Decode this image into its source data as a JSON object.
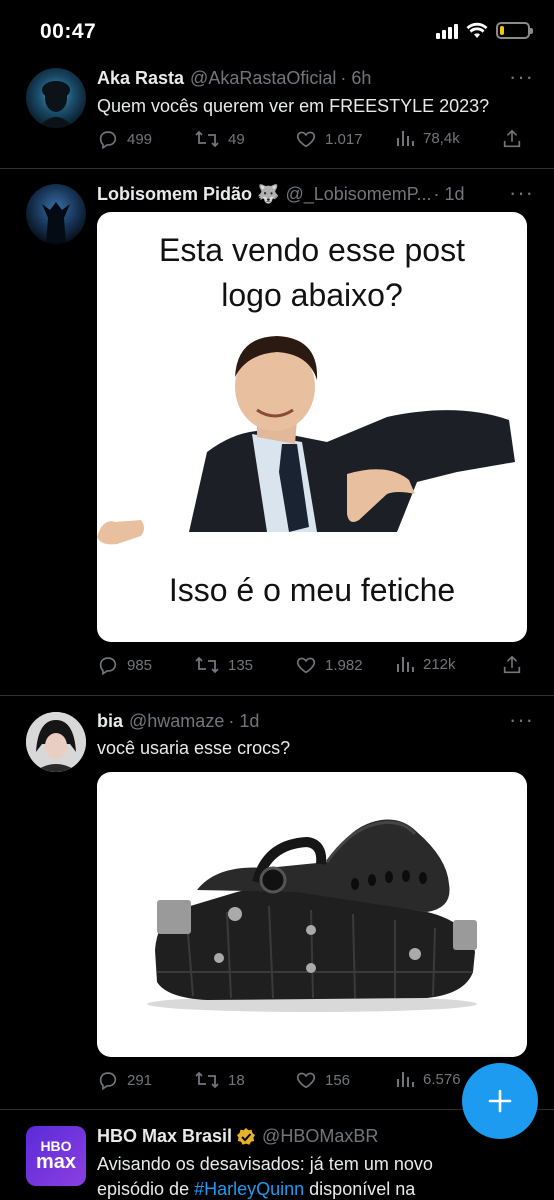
{
  "status": {
    "time": "00:47"
  },
  "tweets": [
    {
      "name": "Aka Rasta",
      "handle": "@AkaRastaOficial",
      "time": "· 6h",
      "text": "Quem vocês querem ver em FREESTYLE 2023?",
      "replies": "499",
      "retweets": "49",
      "likes": "1.017",
      "views": "78,4k"
    },
    {
      "name": "Lobisomem Pidão 🐺",
      "handle": "@_LobisomemP...",
      "time": "· 1d",
      "media": {
        "top_text_1": "Esta vendo esse post",
        "top_text_2": "logo abaixo?",
        "bottom_text": "Isso é o meu fetiche"
      },
      "replies": "985",
      "retweets": "135",
      "likes": "1.982",
      "views": "212k"
    },
    {
      "name": "bia",
      "handle": "@hwamaze",
      "time": "· 1d",
      "text": "você usaria esse crocs?",
      "replies": "291",
      "retweets": "18",
      "likes": "156",
      "views": "6.576"
    },
    {
      "name": "HBO Max Brasil",
      "handle": "@HBOMaxBR",
      "avatar_text_1": "HBO",
      "avatar_text_2": "max",
      "text_1": "Avisando os desavisados: já tem um novo",
      "text_2_a": "episódio de",
      "text_2_hashtag": "#HarleyQuinn",
      "text_2_b": "disponível na"
    }
  ],
  "colors": {
    "accent": "#1d9bf0",
    "muted": "#71767b",
    "text": "#e7e9ea",
    "divider": "#2f3336",
    "battery": "#f7c600"
  }
}
